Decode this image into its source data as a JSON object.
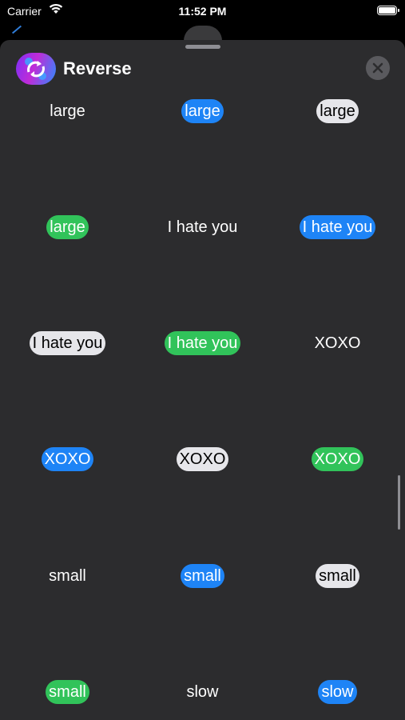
{
  "status_bar": {
    "carrier": "Carrier",
    "time": "11:52 PM"
  },
  "header": {
    "title": "Reverse"
  },
  "stickers": [
    {
      "text": "large",
      "style": "plain"
    },
    {
      "text": "large",
      "style": "blue"
    },
    {
      "text": "large",
      "style": "white"
    },
    {
      "text": "large",
      "style": "green"
    },
    {
      "text": "I hate you",
      "style": "plain"
    },
    {
      "text": "I hate you",
      "style": "blue"
    },
    {
      "text": "I hate you",
      "style": "white"
    },
    {
      "text": "I hate you",
      "style": "green"
    },
    {
      "text": "XOXO",
      "style": "plain"
    },
    {
      "text": "XOXO",
      "style": "blue"
    },
    {
      "text": "XOXO",
      "style": "white"
    },
    {
      "text": "XOXO",
      "style": "green"
    },
    {
      "text": "small",
      "style": "plain"
    },
    {
      "text": "small",
      "style": "blue"
    },
    {
      "text": "small",
      "style": "white"
    },
    {
      "text": "small",
      "style": "green"
    },
    {
      "text": "slow",
      "style": "plain"
    },
    {
      "text": "slow",
      "style": "blue"
    }
  ],
  "colors": {
    "blue": "#1e84f6",
    "green": "#31c35a",
    "white": "#e6e6ea",
    "sheet": "#2c2c2e"
  }
}
